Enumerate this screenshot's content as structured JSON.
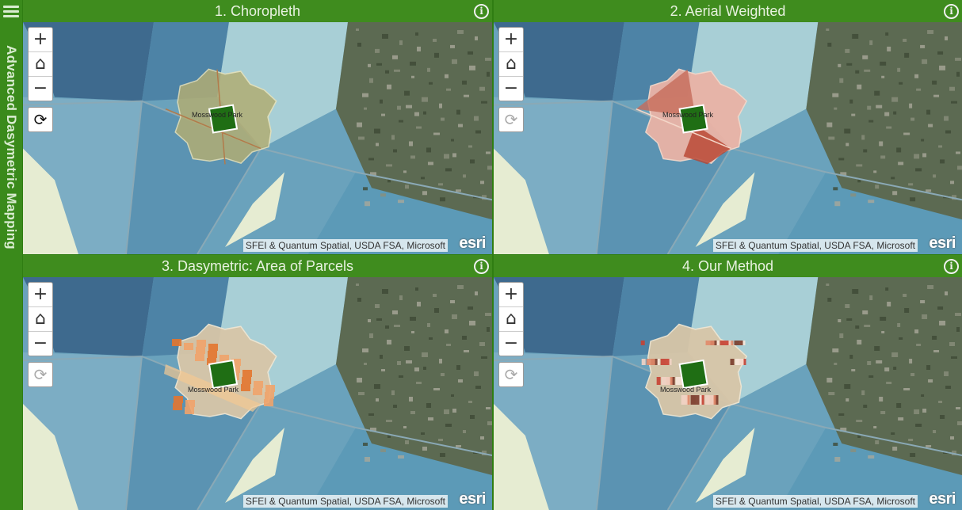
{
  "app": {
    "title": "Advanced Dasymetric Mapping"
  },
  "panels": [
    {
      "title": "1. Choropleth",
      "method": "choropleth",
      "refresh_active": true
    },
    {
      "title": "2. Aerial Weighted",
      "method": "aerial",
      "refresh_active": false
    },
    {
      "title": "3. Dasymetric: Area of Parcels",
      "method": "parcels",
      "refresh_active": false
    },
    {
      "title": "4. Our Method",
      "method": "ours",
      "refresh_active": false
    }
  ],
  "map": {
    "park_label": "Mosswood Park",
    "attribution": "SFEI & Quantum Spatial, USDA FSA, Microsoft",
    "logo": "esri"
  },
  "controls": {
    "zoom_in": "+",
    "home": "⌂",
    "zoom_out": "−",
    "refresh": "⟳",
    "info": "i"
  },
  "icons": [
    "menu-icon",
    "info-icon",
    "zoom-in-icon",
    "home-icon",
    "zoom-out-icon",
    "refresh-icon"
  ],
  "colors": {
    "header": "#3f8c1e",
    "sidebar": "#3a8a1b",
    "tract_dark": "#3e6a8e",
    "tract_mid": "#6aa2bc",
    "tract_light": "#a8cfd6",
    "tract_pale": "#e6ecd2",
    "park": "#1f6e14",
    "aerial_imagery": "#5c6a52"
  }
}
